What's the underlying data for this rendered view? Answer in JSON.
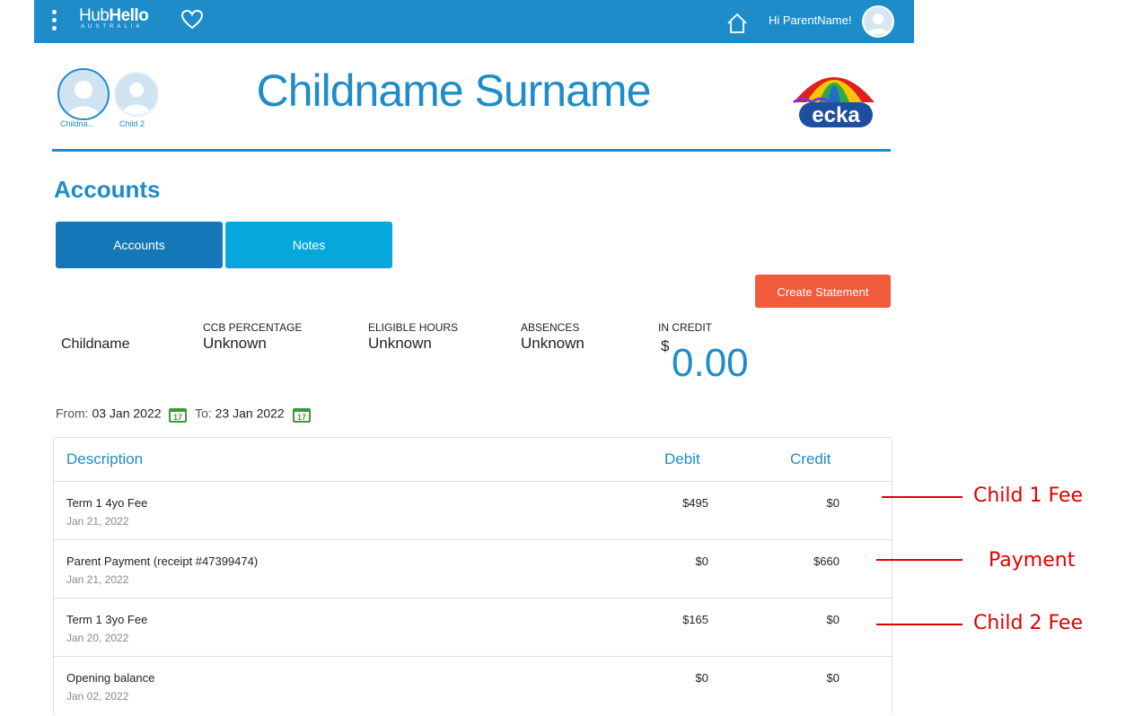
{
  "topbar": {
    "logo_main_thin": "Hub",
    "logo_main_bold": "Hello",
    "logo_sub": "AUSTRALIA",
    "greeting": "Hi ParentName!"
  },
  "children": [
    {
      "label": "Childna..."
    },
    {
      "label": "Child 2"
    }
  ],
  "child_title": "Childname Surname",
  "section_title": "Accounts",
  "tabs": [
    {
      "label": "Accounts"
    },
    {
      "label": "Notes"
    }
  ],
  "create_statement": "Create Statement",
  "summary": {
    "child": "Childname",
    "ccb_label": "CCB PERCENTAGE",
    "ccb_value": "Unknown",
    "hours_label": "ELIGIBLE HOURS",
    "hours_value": "Unknown",
    "absences_label": "ABSENCES",
    "absences_value": "Unknown",
    "credit_label": "IN CREDIT",
    "credit_currency": "$",
    "credit_amount": "0.00"
  },
  "date_range": {
    "from_label": "From:",
    "from": "03 Jan 2022",
    "to_label": "To:",
    "to": "23 Jan 2022"
  },
  "table": {
    "headers": {
      "description": "Description",
      "debit": "Debit",
      "credit": "Credit"
    },
    "rows": [
      {
        "description": "Term 1 4yo Fee",
        "date": "Jan 21, 2022",
        "debit": "$495",
        "credit": "$0"
      },
      {
        "description": "Parent Payment (receipt #47399474)",
        "date": "Jan 21, 2022",
        "debit": "$0",
        "credit": "$660"
      },
      {
        "description": "Term 1 3yo Fee",
        "date": "Jan 20, 2022",
        "debit": "$165",
        "credit": "$0"
      },
      {
        "description": "Opening balance",
        "date": "Jan 02, 2022",
        "debit": "$0",
        "credit": "$0"
      }
    ]
  },
  "annotations": [
    "Child 1 Fee",
    "Payment",
    "Child 2 Fee"
  ],
  "colors": {
    "primary": "#1e8cc8",
    "tab_active": "#1478b8",
    "tab_inactive": "#06a8dc",
    "cta": "#f15a3a",
    "annotation": "#e00000"
  }
}
